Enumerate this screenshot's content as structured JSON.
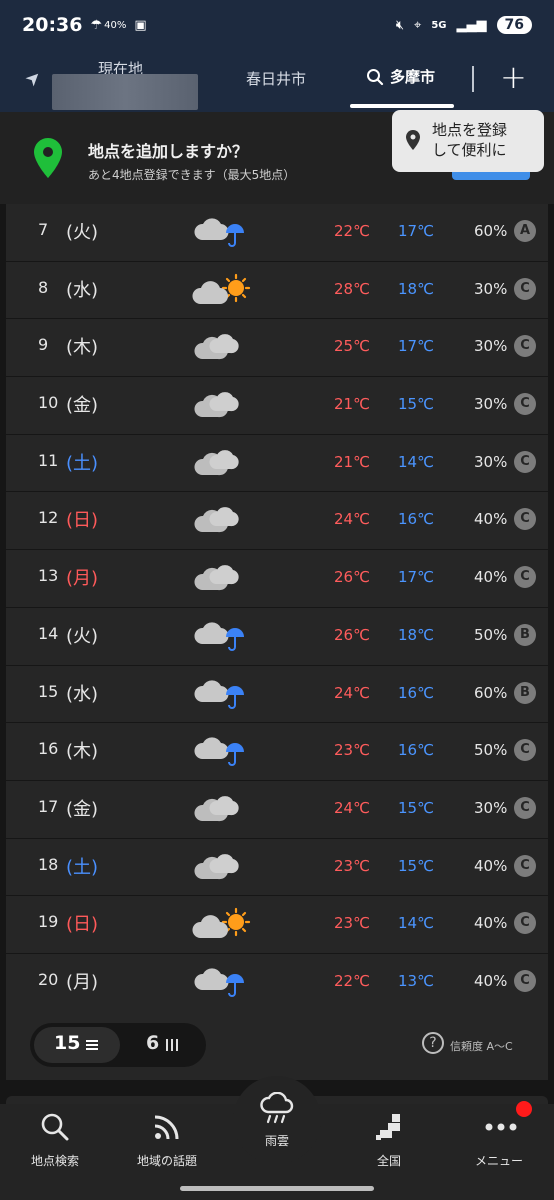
{
  "status_bar": {
    "time": "20:36",
    "rain_pct": "40%",
    "network": "5G",
    "battery": "76"
  },
  "header": {
    "current_location_label": "現在地",
    "tabs": [
      {
        "label": "春日井市"
      },
      {
        "label": "多摩市"
      }
    ]
  },
  "banner": {
    "title": "地点を追加しますか？",
    "subtitle": "あと4地点登録できます（最大5地点）",
    "tooltip_line1": "地点を登録",
    "tooltip_line2": "して便利に"
  },
  "forecast": [
    {
      "day": "7",
      "weekday": "(火)",
      "type": "normal",
      "icon": "cloud-rain-icon",
      "hi": "22℃",
      "lo": "17℃",
      "pop": "60%",
      "rel": "A"
    },
    {
      "day": "8",
      "weekday": "(水)",
      "type": "normal",
      "icon": "cloud-sun-icon",
      "hi": "28℃",
      "lo": "18℃",
      "pop": "30%",
      "rel": "C"
    },
    {
      "day": "9",
      "weekday": "(木)",
      "type": "normal",
      "icon": "cloud-icon",
      "hi": "25℃",
      "lo": "17℃",
      "pop": "30%",
      "rel": "C"
    },
    {
      "day": "10",
      "weekday": "(金)",
      "type": "normal",
      "icon": "cloud-icon",
      "hi": "21℃",
      "lo": "15℃",
      "pop": "30%",
      "rel": "C"
    },
    {
      "day": "11",
      "weekday": "(土)",
      "type": "sat",
      "icon": "cloud-icon",
      "hi": "21℃",
      "lo": "14℃",
      "pop": "30%",
      "rel": "C"
    },
    {
      "day": "12",
      "weekday": "(日)",
      "type": "sun",
      "icon": "cloud-icon",
      "hi": "24℃",
      "lo": "16℃",
      "pop": "40%",
      "rel": "C"
    },
    {
      "day": "13",
      "weekday": "(月)",
      "type": "sun",
      "icon": "cloud-icon",
      "hi": "26℃",
      "lo": "17℃",
      "pop": "40%",
      "rel": "C"
    },
    {
      "day": "14",
      "weekday": "(火)",
      "type": "normal",
      "icon": "cloud-rain-icon",
      "hi": "26℃",
      "lo": "18℃",
      "pop": "50%",
      "rel": "B"
    },
    {
      "day": "15",
      "weekday": "(水)",
      "type": "normal",
      "icon": "cloud-rain-icon",
      "hi": "24℃",
      "lo": "16℃",
      "pop": "60%",
      "rel": "B"
    },
    {
      "day": "16",
      "weekday": "(木)",
      "type": "normal",
      "icon": "cloud-rain-icon",
      "hi": "23℃",
      "lo": "16℃",
      "pop": "50%",
      "rel": "C"
    },
    {
      "day": "17",
      "weekday": "(金)",
      "type": "normal",
      "icon": "cloud-icon",
      "hi": "24℃",
      "lo": "15℃",
      "pop": "30%",
      "rel": "C"
    },
    {
      "day": "18",
      "weekday": "(土)",
      "type": "sat",
      "icon": "cloud-icon",
      "hi": "23℃",
      "lo": "15℃",
      "pop": "40%",
      "rel": "C"
    },
    {
      "day": "19",
      "weekday": "(日)",
      "type": "sun",
      "icon": "cloud-sun-icon",
      "hi": "23℃",
      "lo": "14℃",
      "pop": "40%",
      "rel": "C"
    },
    {
      "day": "20",
      "weekday": "(月)",
      "type": "normal",
      "icon": "cloud-rain-icon",
      "hi": "22℃",
      "lo": "13℃",
      "pop": "40%",
      "rel": "C"
    }
  ],
  "controls": {
    "toggle_15": "15",
    "toggle_6": "6",
    "reliability_label": "信頼度 A〜C"
  },
  "nav": {
    "search": "地点検索",
    "topics": "地域の話題",
    "rain": "雨雲",
    "nationwide": "全国",
    "menu": "メニュー"
  },
  "colors": {
    "header_bg": "#1d2a3f",
    "high": "#ff5c5c",
    "low": "#4b95ff",
    "saturday": "#4a90ff",
    "sunday": "#ff5a5a",
    "banner_pin": "#1fbf3a"
  }
}
